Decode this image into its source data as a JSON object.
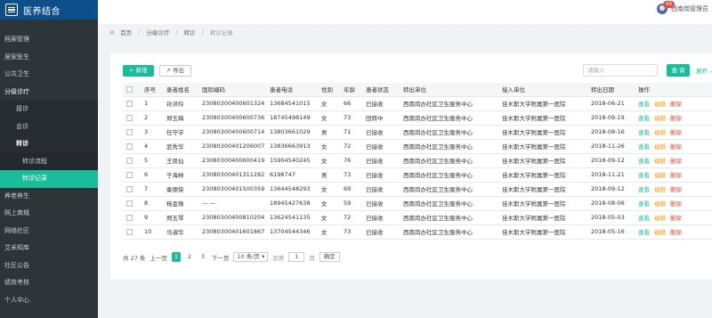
{
  "app": {
    "title": "医养结合"
  },
  "sidebar": {
    "items": [
      {
        "label": "档案管理"
      },
      {
        "label": "居家医生"
      },
      {
        "label": "公共卫生"
      },
      {
        "label": "分级诊疗"
      },
      {
        "label": "接诊"
      },
      {
        "label": "会诊"
      },
      {
        "label": "转诊"
      },
      {
        "label": "转诊流程"
      },
      {
        "label": "转诊记录"
      },
      {
        "label": "养老养生"
      },
      {
        "label": "网上商城"
      },
      {
        "label": "网络社区"
      },
      {
        "label": "艾米知库"
      },
      {
        "label": "社区公告"
      },
      {
        "label": "绩效考核"
      },
      {
        "label": "个人中心"
      }
    ]
  },
  "topbar": {
    "user_name": "西南岗管理员",
    "badge": "99"
  },
  "breadcrumb": {
    "home": "首页",
    "level1": "分级诊疗",
    "level2": "转诊",
    "current": "转诊记录"
  },
  "toolbar": {
    "add_label": "+ 新增",
    "export_label": "导出"
  },
  "search": {
    "placeholder": "请输入",
    "button_label": "查 询",
    "expand_label": "展开 ↗"
  },
  "table": {
    "headers": [
      "",
      "序号",
      "患者姓名",
      "国际编码",
      "患者电话",
      "性别",
      "年龄",
      "患者状态",
      "转出单位",
      "接入单位",
      "转出日期",
      "操作"
    ],
    "actions": {
      "view": "查看",
      "edit": "编辑",
      "del": "删除"
    },
    "rows": [
      [
        "1",
        "孙洪玲",
        "23080300400601324",
        "13684541015",
        "女",
        "66",
        "已接收",
        "西南岗办社区卫生服务中心",
        "佳木斯大学附属第一医院",
        "2018-06-21"
      ],
      [
        "2",
        "郑玉梅",
        "23080300400600736",
        "18745498149",
        "女",
        "73",
        "回转中",
        "西南岗办社区卫生服务中心",
        "佳木斯大学附属第一医院",
        "2018-09-19"
      ],
      [
        "3",
        "任守学",
        "23080300400600714",
        "13803661029",
        "男",
        "71",
        "已接收",
        "西南岗办社区卫生服务中心",
        "佳木斯大学附属第一医院",
        "2018-08-16"
      ],
      [
        "4",
        "武秀华",
        "23080300401206007",
        "13836663913",
        "女",
        "72",
        "已接收",
        "西南岗办社区卫生服务中心",
        "佳木斯大学附属第一医院",
        "2018-11-26"
      ],
      [
        "5",
        "王凤仙",
        "23080300400600419",
        "15904540245",
        "女",
        "76",
        "已接收",
        "西南岗办社区卫生服务中心",
        "佳木斯大学附属第一医院",
        "2018-09-12"
      ],
      [
        "6",
        "于海林",
        "23080300401311282",
        "6198747",
        "男",
        "73",
        "已接收",
        "西南岗办社区卫生服务中心",
        "佳木斯大学附属第一医院",
        "2018-11-21"
      ],
      [
        "7",
        "秦丽侠",
        "23080300401500359",
        "13644548293",
        "女",
        "69",
        "已接收",
        "西南岗办社区卫生服务中心",
        "佳木斯大学附属第一医院",
        "2018-09-12"
      ],
      [
        "8",
        "杨金珠",
        "— —",
        "18945427638",
        "女",
        "59",
        "已接收",
        "西南岗办社区卫生服务中心",
        "佳木斯大学附属第一医院",
        "2018-08-06"
      ],
      [
        "9",
        "郑玉琴",
        "23080300400810204",
        "13624541135",
        "女",
        "72",
        "已接收",
        "西南岗办社区卫生服务中心",
        "佳木斯大学附属第一医院",
        "2018-05-03"
      ],
      [
        "10",
        "马淑华",
        "23080300401601867",
        "13704544346",
        "女",
        "73",
        "已接收",
        "西南岗办社区卫生服务中心",
        "佳木斯大学附属第一医院",
        "2018-05-16"
      ]
    ]
  },
  "pager": {
    "total": "共 27 条",
    "prev": "上一页",
    "pages": [
      "1",
      "2",
      "3"
    ],
    "next": "下一页",
    "page_size": "10 条/页 ▾",
    "goto_label": "到第",
    "goto_value": "1",
    "page_unit": "页",
    "confirm": "确定"
  },
  "colors": {
    "accent": "#1abc9c",
    "sidebar": "#2e3539",
    "logo_bg": "#0d4f8b",
    "edit": "#f39c12",
    "delete": "#e74c3c"
  }
}
